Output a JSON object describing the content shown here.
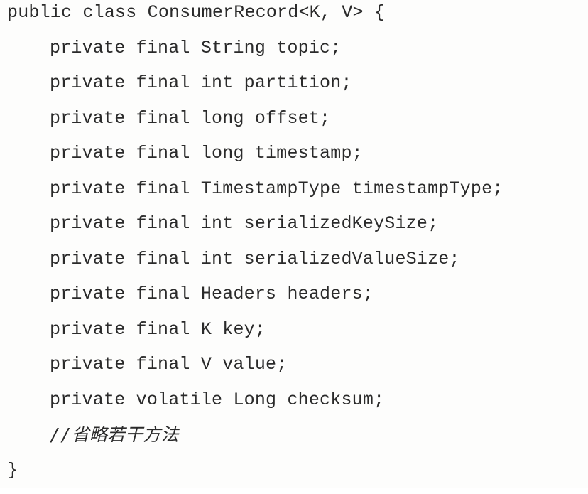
{
  "code": {
    "class_declaration": "public class ConsumerRecord<K, V> {",
    "fields": [
      "private final String topic;",
      "private final int partition;",
      "private final long offset;",
      "private final long timestamp;",
      "private final TimestampType timestampType;",
      "private final int serializedKeySize;",
      "private final int serializedValueSize;",
      "private final Headers headers;",
      "private final K key;",
      "private final V value;",
      "private volatile Long checksum;"
    ],
    "comment": "//省略若干方法",
    "closing_brace": "}"
  }
}
